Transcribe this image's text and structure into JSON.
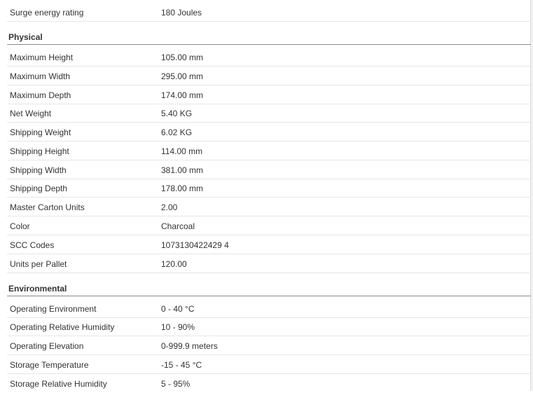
{
  "top_rows": [
    {
      "label": "Surge energy rating",
      "value": "180 Joules"
    }
  ],
  "sections": [
    {
      "title": "Physical",
      "rows": [
        {
          "label": "Maximum Height",
          "value": "105.00 mm"
        },
        {
          "label": "Maximum Width",
          "value": "295.00 mm"
        },
        {
          "label": "Maximum Depth",
          "value": "174.00 mm"
        },
        {
          "label": "Net Weight",
          "value": "5.40 KG"
        },
        {
          "label": "Shipping Weight",
          "value": "6.02 KG"
        },
        {
          "label": "Shipping Height",
          "value": "114.00 mm"
        },
        {
          "label": "Shipping Width",
          "value": "381.00 mm"
        },
        {
          "label": "Shipping Depth",
          "value": "178.00 mm"
        },
        {
          "label": "Master Carton Units",
          "value": "2.00"
        },
        {
          "label": "Color",
          "value": "Charcoal"
        },
        {
          "label": "SCC Codes",
          "value": "1073130422429 4"
        },
        {
          "label": "Units per Pallet",
          "value": "120.00"
        }
      ]
    },
    {
      "title": "Environmental",
      "rows": [
        {
          "label": "Operating Environment",
          "value": "0 - 40 °C"
        },
        {
          "label": "Operating Relative Humidity",
          "value": "10 - 90%"
        },
        {
          "label": "Operating Elevation",
          "value": "0-999.9 meters"
        },
        {
          "label": "Storage Temperature",
          "value": "-15 - 45 °C"
        },
        {
          "label": "Storage Relative Humidity",
          "value": "5 - 95%"
        }
      ]
    }
  ]
}
